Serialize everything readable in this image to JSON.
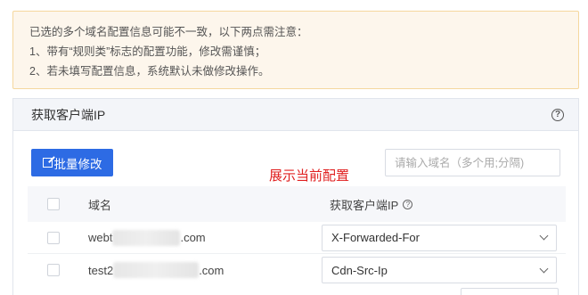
{
  "notice": {
    "lines": [
      "已选的多个域名配置信息可能不一致，以下两点需注意：",
      "1、带有“规则类”标志的配置功能，修改需谨慎；",
      "2、若未填写配置信息，系统默认未做修改操作。"
    ]
  },
  "panel": {
    "title": "获取客户端IP",
    "help_icon": "question-circle-icon"
  },
  "toolbar": {
    "batch_label": "批量修改",
    "batch_icon": "edit-icon",
    "search_placeholder": "请输入域名（多个用;分隔)"
  },
  "annotation": {
    "text": "展示当前配置",
    "color": "#e02020"
  },
  "table": {
    "headers": {
      "domain": "域名",
      "ip": "获取客户端IP"
    },
    "rows": [
      {
        "domain_prefix": "webt",
        "domain_suffix": ".com",
        "ip": "X-Forwarded-For"
      },
      {
        "domain_prefix": "test2",
        "domain_suffix": ".com",
        "ip": "Cdn-Src-Ip"
      }
    ]
  },
  "colors": {
    "primary": "#2d6be4",
    "notice_bg": "#fdf6ec",
    "notice_border": "#f5d79e",
    "annotation": "#e02020"
  }
}
